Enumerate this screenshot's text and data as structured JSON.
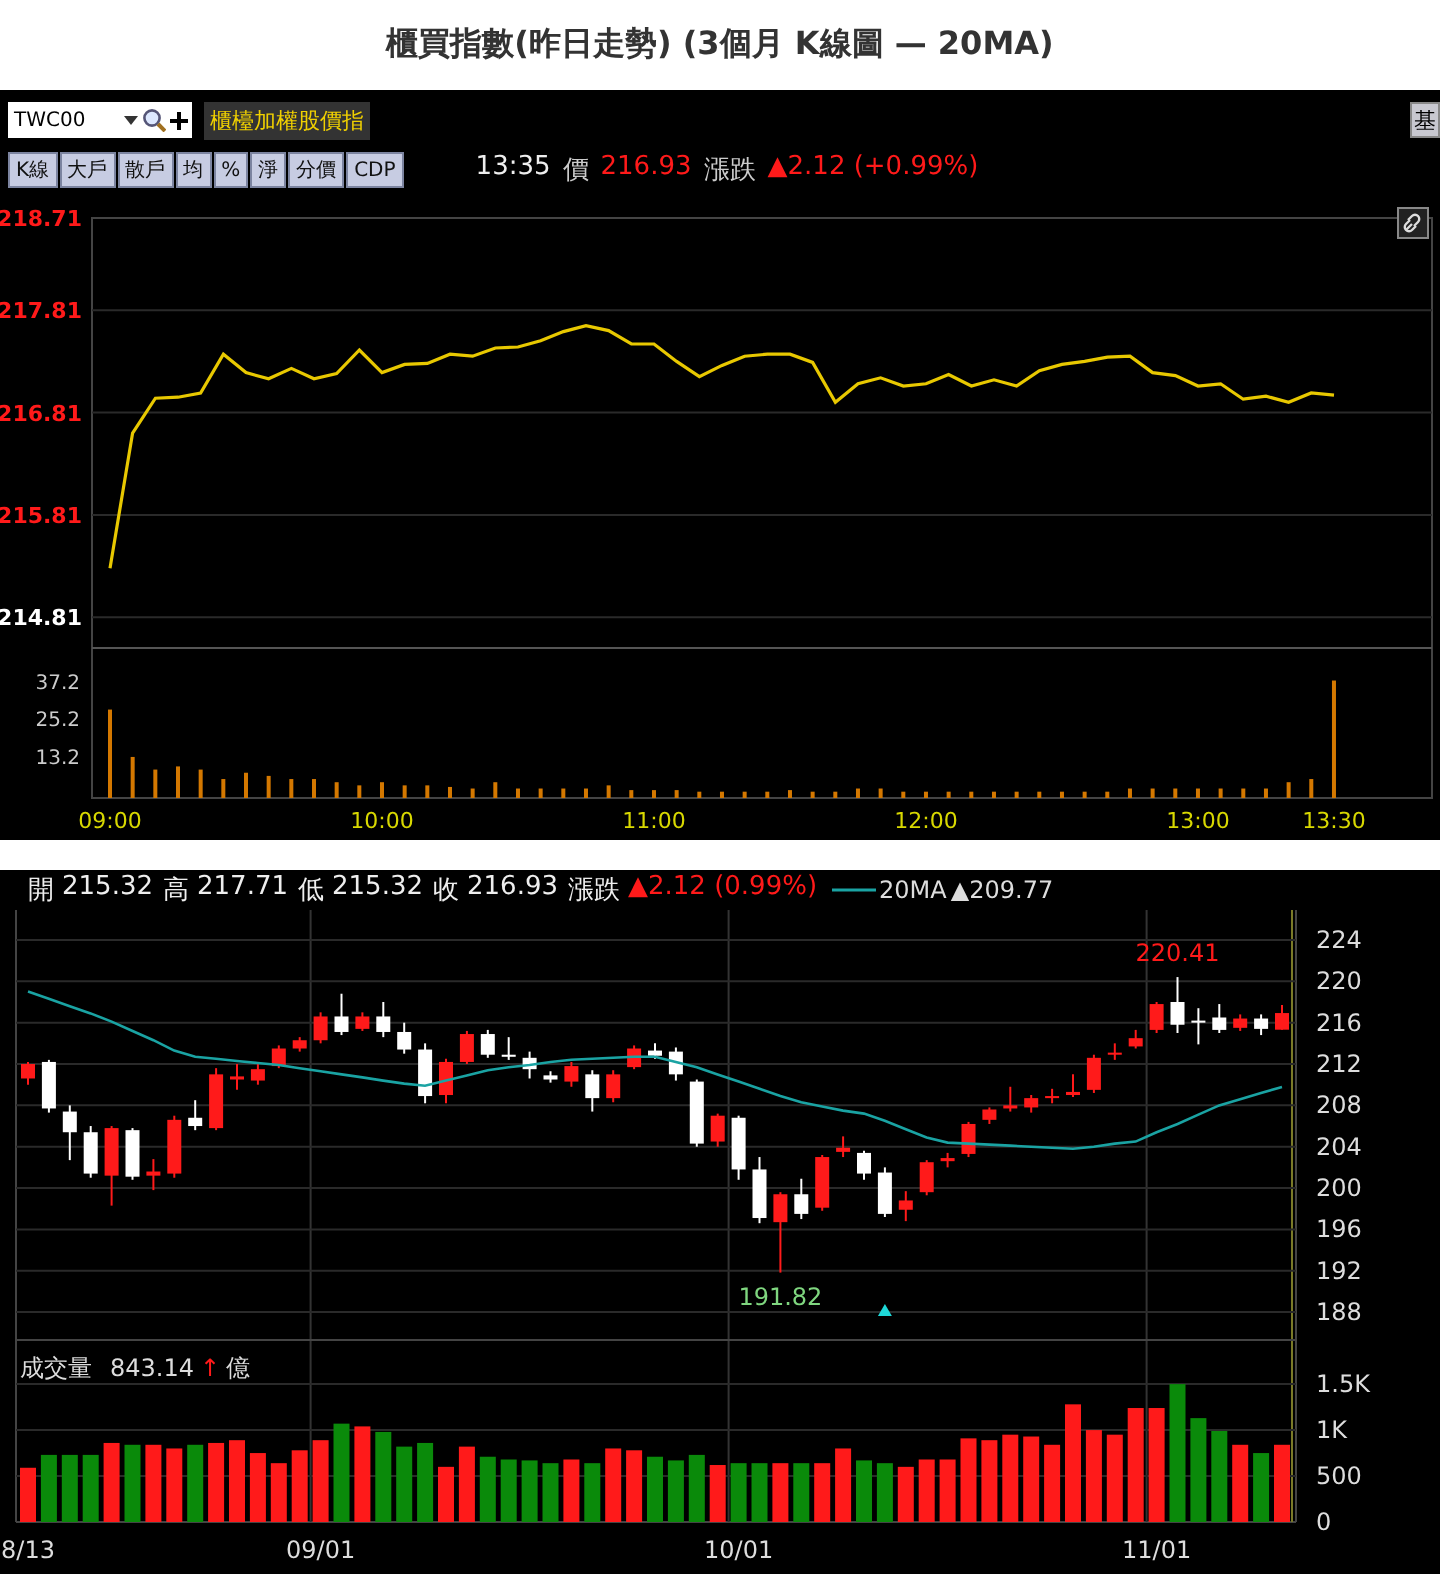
{
  "title": "櫃買指數(昨日走勢) (3個月 K線圖  — 20MA)",
  "intraday": {
    "symbol": "TWC00",
    "index_name": "櫃檯加權股價指",
    "side_button": "基",
    "modes": [
      {
        "label": "K線",
        "selected": false
      },
      {
        "label": "大戶",
        "selected": false
      },
      {
        "label": "散戶",
        "selected": false
      },
      {
        "label": "均",
        "selected": false
      },
      {
        "label": "%",
        "selected": false
      },
      {
        "label": "淨",
        "selected": false
      },
      {
        "label": "分價",
        "selected": false
      },
      {
        "label": "CDP",
        "selected": false
      }
    ],
    "quote": {
      "time": "13:35",
      "price_label": "價",
      "price": "216.93",
      "change_label": "漲跌",
      "change": "▲2.12 (+0.99%)"
    },
    "price_chart": {
      "chart_data": {
        "type": "line",
        "grid": true,
        "categories": [
          null,
          null,
          null,
          null,
          null,
          null,
          null,
          null,
          null,
          null,
          null,
          null,
          null,
          null,
          null,
          null,
          null,
          null,
          null,
          null,
          null,
          null,
          null,
          null,
          null,
          null,
          null,
          null,
          null,
          null,
          null,
          null,
          null,
          null,
          null,
          null,
          null,
          null,
          null,
          null,
          null,
          null,
          null,
          null,
          null,
          null,
          null,
          null,
          null,
          null,
          null,
          null,
          null,
          null,
          null
        ],
        "series": [
          {
            "color": "#e8c800",
            "values": [
              215.29,
              216.61,
              216.95,
              216.96,
              217.0,
              217.38,
              217.2,
              217.14,
              217.24,
              217.14,
              217.19,
              217.42,
              217.2,
              217.28,
              217.29,
              217.38,
              217.36,
              217.44,
              217.45,
              217.51,
              217.6,
              217.66,
              217.61,
              217.48,
              217.48,
              217.31,
              217.16,
              217.27,
              217.36,
              217.38,
              217.38,
              217.3,
              216.91,
              217.09,
              217.15,
              217.07,
              217.09,
              217.18,
              217.07,
              217.13,
              217.07,
              217.22,
              217.28,
              217.31,
              217.35,
              217.36,
              217.2,
              217.17,
              217.07,
              217.09,
              216.94,
              216.97,
              216.91,
              217.0,
              216.98
            ]
          }
        ],
        "ylim": [
          214.51,
          218.71
        ],
        "yticks": [
          {
            "value": 218.71,
            "label": "218.71"
          },
          {
            "value": 217.81,
            "label": "217.81"
          },
          {
            "value": 216.81,
            "label": "216.81"
          },
          {
            "value": 215.81,
            "label": "215.81"
          },
          {
            "value": 214.81,
            "label": "214.81"
          }
        ]
      }
    },
    "volume_chart": {
      "chart_data": {
        "type": "bar",
        "categories": [
          "09:00",
          null,
          null,
          null,
          null,
          null,
          null,
          null,
          null,
          null,
          null,
          null,
          "10:00",
          null,
          null,
          null,
          null,
          null,
          null,
          null,
          null,
          null,
          null,
          null,
          "11:00",
          null,
          null,
          null,
          null,
          null,
          null,
          null,
          null,
          null,
          null,
          null,
          "12:00",
          null,
          null,
          null,
          null,
          null,
          null,
          null,
          null,
          null,
          null,
          null,
          "13:00",
          null,
          null,
          null,
          null,
          null,
          "13:30"
        ],
        "series": [
          {
            "color": "#d47800",
            "values": [
              28,
              13,
              9,
              10,
              9,
              6,
              8,
              7,
              6,
              6,
              5,
              4,
              5,
              4,
              4,
              3.5,
              3,
              5,
              3,
              3,
              3,
              3,
              4,
              2.5,
              2.5,
              2.5,
              2,
              2,
              2,
              2,
              2.5,
              2,
              2,
              3,
              3,
              2,
              2,
              2,
              2,
              2,
              2,
              2,
              2,
              2,
              2,
              3,
              3,
              3,
              3,
              3,
              3,
              3,
              5,
              6,
              37.2
            ]
          }
        ],
        "ylim": [
          0,
          47.5
        ],
        "yticks": [
          {
            "value": 13.2,
            "label": "13.2"
          },
          {
            "value": 25.2,
            "label": "25.2"
          },
          {
            "value": 37.2,
            "label": "37.2"
          }
        ]
      }
    }
  },
  "kline": {
    "header": [
      {
        "label": "開",
        "value": "215.32"
      },
      {
        "label": "高",
        "value": "217.71"
      },
      {
        "label": "低",
        "value": "215.32"
      },
      {
        "label": "收",
        "value": "216.93"
      }
    ],
    "change": {
      "label": "漲跌",
      "value": "▲2.12 (0.99%)"
    },
    "ma_value": "▲209.77",
    "price_chart": {
      "chart_data": {
        "type": "candlestick",
        "grid": true,
        "categories": [
          null,
          null,
          null,
          null,
          null,
          null,
          null,
          null,
          null,
          null,
          null,
          null,
          null,
          null,
          null,
          null,
          null,
          null,
          null,
          null,
          null,
          null,
          null,
          null,
          null,
          null,
          null,
          null,
          null,
          null,
          null,
          null,
          null,
          null,
          null,
          null,
          null,
          null,
          null,
          null,
          null,
          null,
          null,
          null,
          null,
          null,
          null,
          null,
          null,
          null,
          null,
          null,
          null,
          null,
          null,
          null,
          null,
          null,
          null,
          null,
          null
        ],
        "ohlc": [
          [
            210.6,
            212.2,
            210,
            212
          ],
          [
            212.2,
            212.4,
            207.3,
            207.7
          ],
          [
            207.4,
            208,
            202.7,
            205.4
          ],
          [
            205.4,
            206,
            201,
            201.4
          ],
          [
            201.2,
            206,
            198.3,
            205.8
          ],
          [
            205.6,
            205.8,
            200.8,
            201.1
          ],
          [
            201.2,
            202.8,
            199.8,
            201.6
          ],
          [
            201.4,
            207,
            201,
            206.6
          ],
          [
            206.8,
            208.5,
            205.6,
            206
          ],
          [
            205.8,
            211.6,
            205.6,
            211
          ],
          [
            210.5,
            212,
            209.5,
            210.8
          ],
          [
            210.4,
            212,
            210,
            211.5
          ],
          [
            211.8,
            213.8,
            211.6,
            213.5
          ],
          [
            213.5,
            214.6,
            213.2,
            214.3
          ],
          [
            214.3,
            217,
            214,
            216.6
          ],
          [
            216.6,
            218.8,
            214.8,
            215.1
          ],
          [
            215.4,
            217,
            215.2,
            216.6
          ],
          [
            216.6,
            218,
            214.6,
            215.1
          ],
          [
            215.1,
            216,
            213,
            213.4
          ],
          [
            213.4,
            214,
            208.2,
            208.9
          ],
          [
            209,
            212.5,
            208.2,
            212.2
          ],
          [
            212.2,
            215.2,
            212,
            214.9
          ],
          [
            214.9,
            215.3,
            212.6,
            212.9
          ],
          [
            212.9,
            214.6,
            212.4,
            212.7
          ],
          [
            212.6,
            213.2,
            210.6,
            211.5
          ],
          [
            210.9,
            211.3,
            210.2,
            210.5
          ],
          [
            210.3,
            212.2,
            209.8,
            211.8
          ],
          [
            211,
            211.4,
            207.4,
            208.7
          ],
          [
            208.7,
            211.4,
            208.3,
            211
          ],
          [
            211.7,
            213.8,
            211.5,
            213.5
          ],
          [
            213.3,
            214,
            212.5,
            212.8
          ],
          [
            213.2,
            213.6,
            210.4,
            211
          ],
          [
            210.3,
            210.5,
            204,
            204.3
          ],
          [
            204.5,
            207.2,
            204,
            207
          ],
          [
            206.8,
            207,
            200.8,
            201.8
          ],
          [
            201.8,
            203,
            196.6,
            197.1
          ],
          [
            196.7,
            199.6,
            191.82,
            199.4
          ],
          [
            199.4,
            200.9,
            197,
            197.5
          ],
          [
            198.1,
            203.2,
            197.8,
            203
          ],
          [
            203.5,
            205,
            203,
            203.9
          ],
          [
            203.4,
            203.6,
            200.8,
            201.4
          ],
          [
            201.5,
            202,
            197.2,
            197.5
          ],
          [
            197.9,
            199.7,
            196.8,
            198.8
          ],
          [
            199.6,
            202.7,
            199.3,
            202.5
          ],
          [
            202.6,
            203.4,
            202,
            202.9
          ],
          [
            203.3,
            206.4,
            203,
            206.2
          ],
          [
            206.6,
            207.8,
            206.2,
            207.6
          ],
          [
            207.7,
            209.8,
            207.4,
            208
          ],
          [
            207.8,
            209,
            207.3,
            208.7
          ],
          [
            208.7,
            209.6,
            208.2,
            208.9
          ],
          [
            209,
            211,
            208.8,
            209.3
          ],
          [
            209.5,
            212.9,
            209.2,
            212.6
          ],
          [
            212.9,
            214,
            212.4,
            213.1
          ],
          [
            213.7,
            215.3,
            213.5,
            214.5
          ],
          [
            215.3,
            218,
            215,
            217.8
          ],
          [
            218,
            220.41,
            215,
            215.8
          ],
          [
            216.2,
            217.4,
            213.9,
            216
          ],
          [
            216.5,
            217.8,
            215,
            215.3
          ],
          [
            215.5,
            216.8,
            215.2,
            216.4
          ],
          [
            216.4,
            216.8,
            214.8,
            215.4
          ],
          [
            215.32,
            217.71,
            215.32,
            216.93
          ]
        ],
        "ylim": [
          185.3,
          226.9
        ],
        "yticks": [
          {
            "value": 188,
            "label": "188"
          },
          {
            "value": 192,
            "label": "192"
          },
          {
            "value": 196,
            "label": "196"
          },
          {
            "value": 200,
            "label": "200"
          },
          {
            "value": 204,
            "label": "204"
          },
          {
            "value": 208,
            "label": "208"
          },
          {
            "value": 212,
            "label": "212"
          },
          {
            "value": 216,
            "label": "216"
          },
          {
            "value": 220,
            "label": "220"
          },
          {
            "value": 224,
            "label": "224"
          }
        ],
        "annotations": [
          {
            "y": 220.41,
            "text": "220.41"
          },
          {
            "y": 191.82,
            "text": "191.82"
          }
        ]
      }
    },
    "ma_chart": {
      "chart_data": {
        "type": "line",
        "categories": [
          null,
          null,
          null,
          null,
          null,
          null,
          null,
          null,
          null,
          null,
          null,
          null,
          null,
          null,
          null,
          null,
          null,
          null,
          null,
          null,
          null,
          null,
          null,
          null,
          null,
          null,
          null,
          null,
          null,
          null,
          null,
          null,
          null,
          null,
          null,
          null,
          null,
          null,
          null,
          null,
          null,
          null,
          null,
          null,
          null,
          null,
          null,
          null,
          null,
          null,
          null,
          null,
          null,
          null,
          null,
          null,
          null,
          null,
          null,
          null,
          null
        ],
        "series": [
          {
            "name": "20MA",
            "color": "#1aa3a3",
            "values": [
              219,
              218.3,
              217.6,
              216.9,
              216.1,
              215.2,
              214.3,
              213.3,
              212.7,
              212.5,
              212.3,
              212.1,
              211.9,
              211.6,
              211.3,
              211,
              210.7,
              210.4,
              210.1,
              209.9,
              210.4,
              210.9,
              211.4,
              211.7,
              211.9,
              212.2,
              212.4,
              212.5,
              212.6,
              212.7,
              212.7,
              212.2,
              211.7,
              211,
              210.3,
              209.6,
              208.9,
              208.3,
              207.9,
              207.5,
              207.2,
              206.5,
              205.7,
              204.9,
              204.4,
              204.3,
              204.2,
              204.1,
              204,
              203.9,
              203.8,
              204,
              204.3,
              204.5,
              205.4,
              206.2,
              207.1,
              208,
              208.6,
              209.2,
              209.77
            ]
          }
        ],
        "ylim": [
          185.3,
          226.9
        ]
      }
    },
    "volume_legend": {
      "label": "成交量",
      "value": "843.14",
      "arrow": "↑",
      "unit": "億"
    },
    "volume_chart": {
      "chart_data": {
        "type": "bar",
        "grid": true,
        "categories": [
          "8/13",
          null,
          null,
          null,
          null,
          null,
          null,
          null,
          null,
          null,
          null,
          null,
          null,
          null,
          "09/01",
          null,
          null,
          null,
          null,
          null,
          null,
          null,
          null,
          null,
          null,
          null,
          null,
          null,
          null,
          null,
          null,
          null,
          null,
          null,
          "10/01",
          null,
          null,
          null,
          null,
          null,
          null,
          null,
          null,
          null,
          null,
          null,
          null,
          null,
          null,
          null,
          null,
          null,
          null,
          null,
          "11/01",
          null,
          null,
          null,
          null,
          null,
          null
        ],
        "series": [
          {
            "values": [
              590,
              730,
              730,
              730,
              860,
              840,
              840,
              800,
              840,
              860,
              890,
              750,
              640,
              780,
              890,
              1070,
              1040,
              980,
              820,
              860,
              600,
              820,
              710,
              680,
              670,
              640,
              680,
              640,
              800,
              780,
              710,
              670,
              730,
              620,
              640,
              640,
              640,
              640,
              640,
              800,
              670,
              640,
              600,
              680,
              680,
              910,
              890,
              950,
              930,
              840,
              1280,
              1000,
              950,
              1240,
              1240,
              1500,
              1130,
              990,
              840,
              750,
              840
            ]
          }
        ],
        "ylim": [
          0,
          1980
        ],
        "yticks": [
          {
            "value": 0,
            "label": "0"
          },
          {
            "value": 500,
            "label": "500"
          },
          {
            "value": 1000,
            "label": "1K"
          },
          {
            "value": 1500,
            "label": "1.5K"
          }
        ]
      }
    }
  }
}
